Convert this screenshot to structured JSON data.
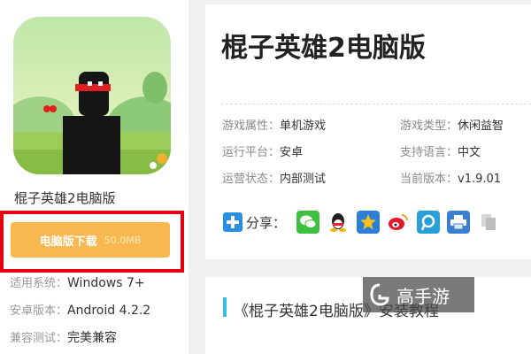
{
  "app": {
    "name": "棍子英雄2电脑版",
    "download_label": "电脑版下载",
    "download_size": "50.0MB"
  },
  "specs": [
    {
      "key": "适用系统：",
      "value": "Windows 7+"
    },
    {
      "key": "安卓版本：",
      "value": "Android 4.2.2"
    },
    {
      "key": "兼容测试：",
      "value": "完美兼容"
    }
  ],
  "info": {
    "title": "棍子英雄2电脑版",
    "attributes": [
      {
        "key": "游戏属性：",
        "value": "单机游戏"
      },
      {
        "key": "游戏类型：",
        "value": "休闲益智"
      },
      {
        "key": "运行平台：",
        "value": "安卓"
      },
      {
        "key": "支持语言：",
        "value": "中文"
      },
      {
        "key": "运营状态：",
        "value": "内部测试"
      },
      {
        "key": "当前版本：",
        "value": "v1.9.01"
      }
    ],
    "share_label": "分享：",
    "share_icons": [
      "wechat-icon",
      "qq-icon",
      "qzone-icon",
      "weibo-icon",
      "tencent-weibo-icon",
      "print-icon",
      "copy-icon"
    ]
  },
  "section": {
    "title": "《棍子英雄2电脑版》安装教程"
  },
  "watermark": {
    "text": "高手游"
  },
  "colors": {
    "download_button": "#f9b84f",
    "highlight_frame": "#e60012",
    "accent": "#36bfe0",
    "share_plus": "#2a8fe1"
  }
}
